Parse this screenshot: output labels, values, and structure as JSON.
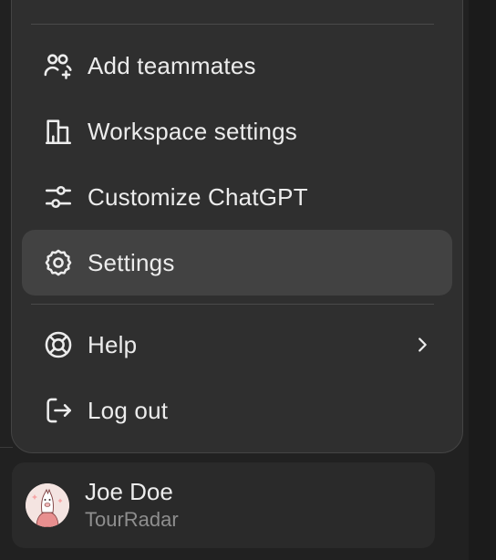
{
  "menu": {
    "items": [
      {
        "label": "Add teammates",
        "icon": "add-teammates-icon"
      },
      {
        "label": "Workspace settings",
        "icon": "building-icon"
      },
      {
        "label": "Customize ChatGPT",
        "icon": "sliders-icon"
      },
      {
        "label": "Settings",
        "icon": "gear-icon",
        "active": true
      },
      {
        "label": "Help",
        "icon": "lifebuoy-icon",
        "has_submenu": true
      },
      {
        "label": "Log out",
        "icon": "logout-icon"
      }
    ]
  },
  "user": {
    "name": "Joe Doe",
    "organization": "TourRadar",
    "avatar": "llama-avatar"
  },
  "colors": {
    "background": "#212121",
    "menu_background": "#2f2f2f",
    "menu_hover": "#424242",
    "text_primary": "#ececec",
    "text_secondary": "#8e8e8e"
  }
}
